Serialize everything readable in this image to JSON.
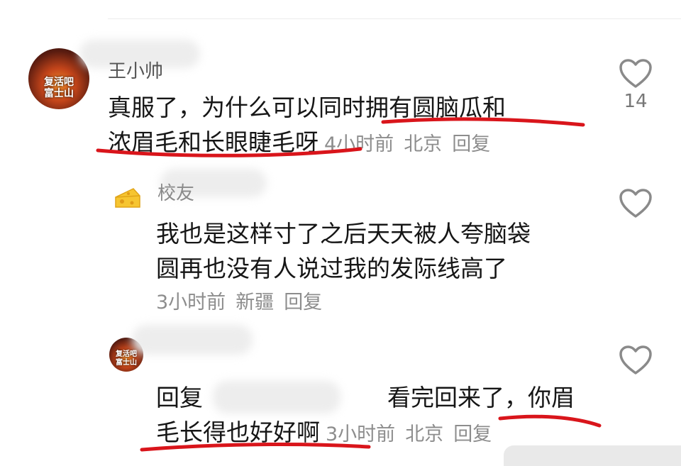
{
  "comments": [
    {
      "username": "王小帅",
      "avatar_text": "复活吧\n富士山",
      "text_line1": "真服了，为什么可以同时拥有圆脑瓜和",
      "text_line2": "浓眉毛和长眼睫毛呀",
      "time": "4小时前",
      "location": "北京",
      "reply_label": "回复",
      "likes": "14"
    },
    {
      "username": "校友",
      "avatar_icon": "cheese-icon",
      "text_line1": "我也是这样寸了之后天天被人夸脑袋",
      "text_line2": "圆再也没有人说过我的发际线高了",
      "time": "3小时前",
      "location": "新疆",
      "reply_label": "回复",
      "likes": ""
    },
    {
      "avatar_text": "复活吧\n富士山",
      "reply_prefix": "回复",
      "text_line1_tail": "看完回来了，你眉",
      "text_line2": "毛长得也好好啊",
      "time": "3小时前",
      "location": "北京",
      "reply_label": "回复",
      "likes": ""
    }
  ],
  "colors": {
    "underline": "#d9151b",
    "meta_text": "#8d8d8d",
    "heart_outline": "#8a8a8a"
  }
}
